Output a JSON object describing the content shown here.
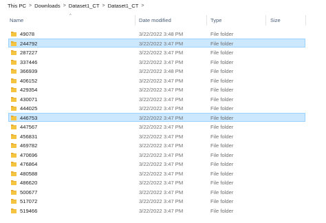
{
  "breadcrumb": {
    "items": [
      "This PC",
      "Downloads",
      "Dataset1_CT",
      "Dataset1_CT"
    ],
    "separator": ">"
  },
  "columns": {
    "name": "Name",
    "date": "Date modified",
    "type": "Type",
    "size": "Size",
    "sort_indicator": "^"
  },
  "colors": {
    "selection_bg": "#cce8ff",
    "selection_border": "#99d1ff",
    "folder_fill": "#f5c542",
    "folder_tab": "#e0a422"
  },
  "files": [
    {
      "name": "49078",
      "date": "3/22/2022 3:48 PM",
      "type": "File folder",
      "selected": false
    },
    {
      "name": "244792",
      "date": "3/22/2022 3:47 PM",
      "type": "File folder",
      "selected": true
    },
    {
      "name": "287227",
      "date": "3/22/2022 3:47 PM",
      "type": "File folder",
      "selected": false
    },
    {
      "name": "337446",
      "date": "3/22/2022 3:47 PM",
      "type": "File folder",
      "selected": false
    },
    {
      "name": "366939",
      "date": "3/22/2022 3:48 PM",
      "type": "File folder",
      "selected": false
    },
    {
      "name": "406152",
      "date": "3/22/2022 3:47 PM",
      "type": "File folder",
      "selected": false
    },
    {
      "name": "429354",
      "date": "3/22/2022 3:47 PM",
      "type": "File folder",
      "selected": false
    },
    {
      "name": "430071",
      "date": "3/22/2022 3:47 PM",
      "type": "File folder",
      "selected": false
    },
    {
      "name": "444025",
      "date": "3/22/2022 3:47 PM",
      "type": "File folder",
      "selected": false
    },
    {
      "name": "446753",
      "date": "3/22/2022 3:47 PM",
      "type": "File folder",
      "selected": true
    },
    {
      "name": "447567",
      "date": "3/22/2022 3:47 PM",
      "type": "File folder",
      "selected": false
    },
    {
      "name": "456831",
      "date": "3/22/2022 3:47 PM",
      "type": "File folder",
      "selected": false
    },
    {
      "name": "469782",
      "date": "3/22/2022 3:47 PM",
      "type": "File folder",
      "selected": false
    },
    {
      "name": "470696",
      "date": "3/22/2022 3:47 PM",
      "type": "File folder",
      "selected": false
    },
    {
      "name": "476864",
      "date": "3/22/2022 3:47 PM",
      "type": "File folder",
      "selected": false
    },
    {
      "name": "480588",
      "date": "3/22/2022 3:47 PM",
      "type": "File folder",
      "selected": false
    },
    {
      "name": "486620",
      "date": "3/22/2022 3:47 PM",
      "type": "File folder",
      "selected": false
    },
    {
      "name": "500677",
      "date": "3/22/2022 3:47 PM",
      "type": "File folder",
      "selected": false
    },
    {
      "name": "517072",
      "date": "3/22/2022 3:47 PM",
      "type": "File folder",
      "selected": false
    },
    {
      "name": "519466",
      "date": "3/22/2022 3:47 PM",
      "type": "File folder",
      "selected": false
    }
  ]
}
